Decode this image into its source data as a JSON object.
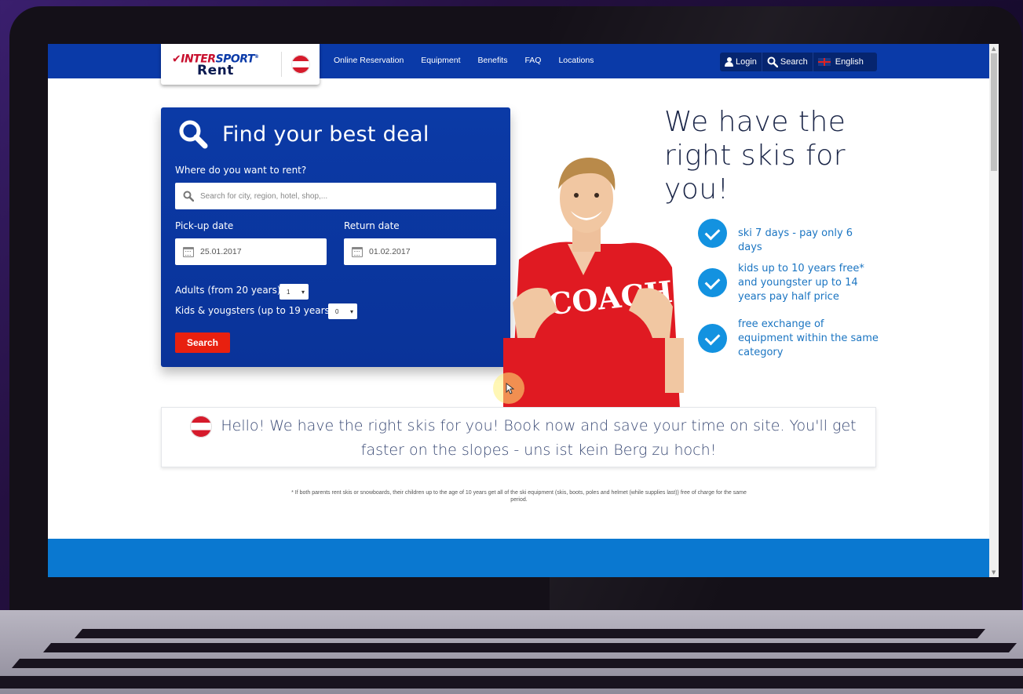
{
  "brand": {
    "logo_line1_a": "INTER",
    "logo_line1_b": "SPORT",
    "logo_line2": "Rent"
  },
  "nav": {
    "links": [
      "Online Reservation",
      "Equipment",
      "Benefits",
      "FAQ",
      "Locations"
    ],
    "login": "Login",
    "search": "Search",
    "language": "English"
  },
  "search_panel": {
    "title": "Find your best deal",
    "where_label": "Where do you want to rent?",
    "where_placeholder": "Search for city, region, hotel, shop,...",
    "pickup_label": "Pick-up date",
    "pickup_value": "25.01.2017",
    "return_label": "Return date",
    "return_value": "01.02.2017",
    "adults_label": "Adults (from 20 years)",
    "adults_value": "1",
    "kids_label": "Kids & yougsters (up to 19 years)",
    "kids_value": "0",
    "search_button": "Search"
  },
  "hero": {
    "title": "We have the right skis for you!",
    "shirt_text": "COACH",
    "benefits": [
      "ski 7 days - pay only 6 days",
      "kids up to 10 years free* and youngster up to 14 years pay half price",
      "free exchange of equipment within the same category"
    ]
  },
  "hello": {
    "text": "Hello! We have the right skis for you! Book now and save your time on site. You'll get faster on the slopes - uns ist kein Berg zu hoch!"
  },
  "footnote": "* If both parents rent skis or snowboards, their children up to the age of 10 years get all of the ski equipment (skis, boots, poles and helmet (while supplies last)) free of charge for the same period.",
  "colors": {
    "nav_blue": "#0a3aa8",
    "accent_red": "#e8200f",
    "check_blue": "#1392e0"
  }
}
